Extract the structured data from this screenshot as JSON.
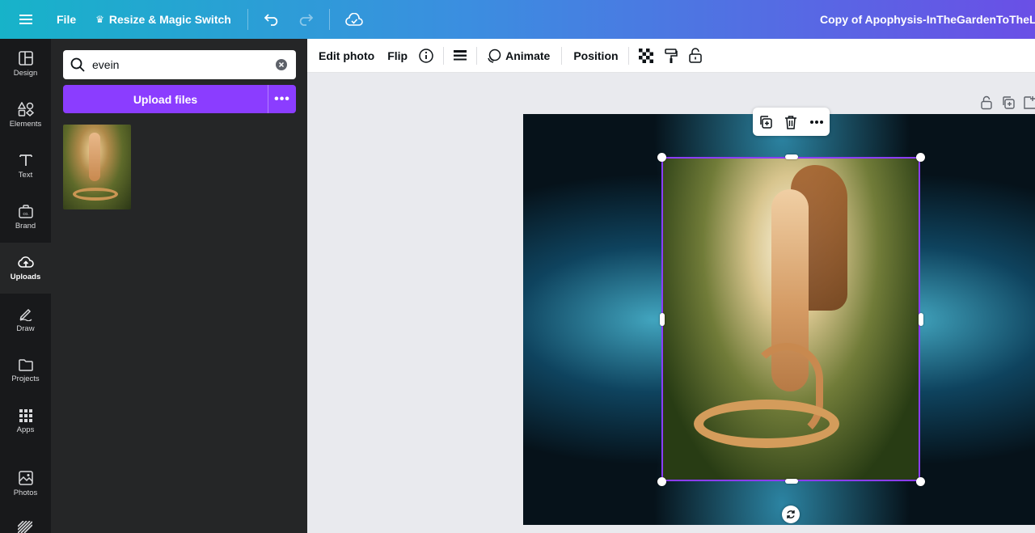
{
  "topbar": {
    "file_label": "File",
    "resize_label": "Resize & Magic Switch",
    "doc_title": "Copy of Apophysis-InTheGardenToTheLeftOf"
  },
  "rail": {
    "items": [
      {
        "label": "Design",
        "icon": "layout-icon"
      },
      {
        "label": "Elements",
        "icon": "shapes-icon"
      },
      {
        "label": "Text",
        "icon": "text-icon"
      },
      {
        "label": "Brand",
        "icon": "brand-icon"
      },
      {
        "label": "Uploads",
        "icon": "upload-cloud-icon",
        "active": true
      },
      {
        "label": "Draw",
        "icon": "pen-icon"
      },
      {
        "label": "Projects",
        "icon": "folder-icon"
      },
      {
        "label": "Apps",
        "icon": "apps-grid-icon"
      },
      {
        "label": "Photos",
        "icon": "photo-icon"
      }
    ]
  },
  "panel": {
    "search_value": "evein",
    "upload_label": "Upload files",
    "more_label": "•••"
  },
  "context_toolbar": {
    "edit_photo": "Edit photo",
    "flip": "Flip",
    "animate": "Animate",
    "position": "Position"
  },
  "colors": {
    "accent": "#8b3dff",
    "rail_bg": "#18191b",
    "panel_bg": "#252627"
  }
}
